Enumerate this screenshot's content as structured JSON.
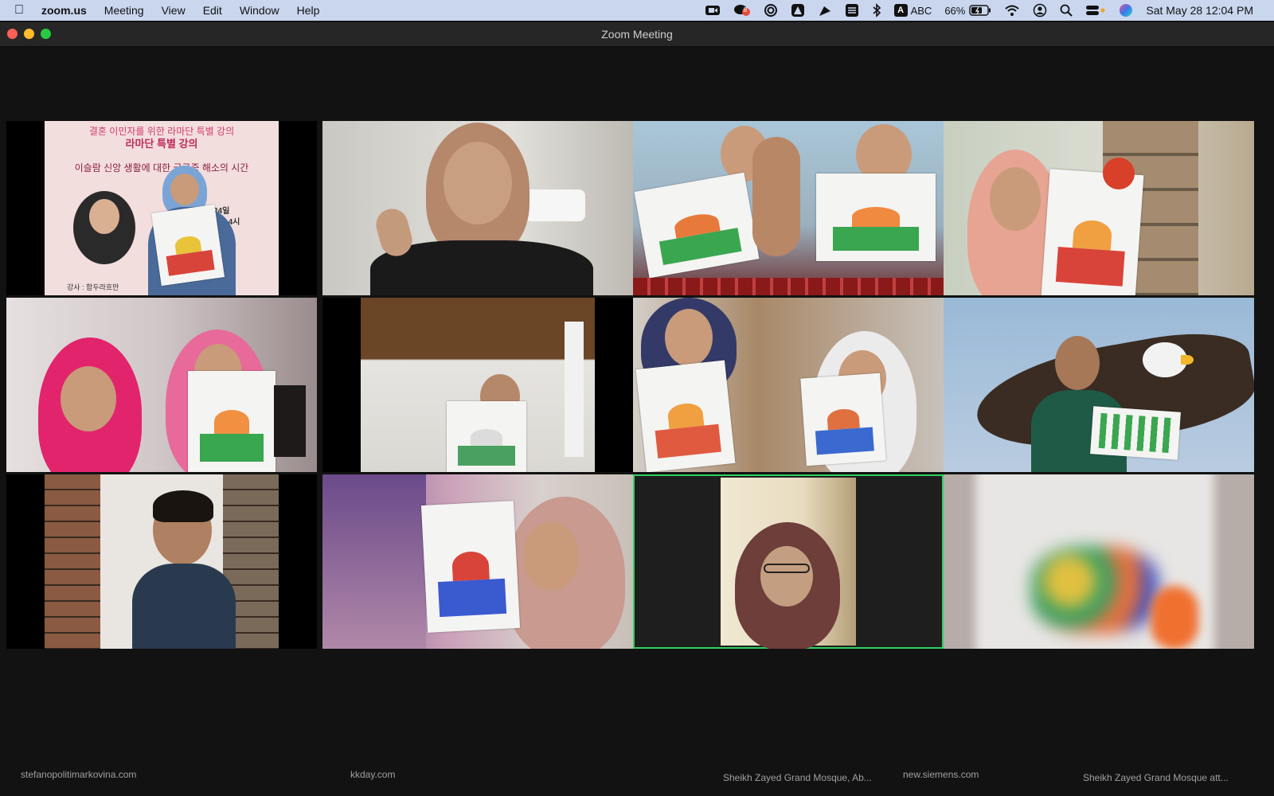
{
  "menubar": {
    "app_name": "zoom.us",
    "menus": [
      "Meeting",
      "View",
      "Edit",
      "Window",
      "Help"
    ],
    "input_source": "ABC",
    "battery": "66%",
    "datetime": "Sat May 28  12:04 PM",
    "notification_badge": "8"
  },
  "window": {
    "title": "Zoom Meeting"
  },
  "bottom_strip": {
    "items": [
      "stefanopolitimarkovina.com",
      "kkday.com",
      "Sheikh Zayed Grand Mosque, Ab...",
      "new.siemens.com",
      "Sheikh Zayed Grand Mosque att..."
    ]
  },
  "colors": {
    "active_speaker_border": "#2fd15f",
    "window_bg": "#121212",
    "menubar_bg": "#c9d6ee"
  },
  "tiles": [
    {
      "id": 1,
      "poster_title": "결혼 이민자를 위한 라마단 특별 강의",
      "poster_subtitle": "라마단 특별 강의",
      "poster_line": "이슬람 신앙 생활에 대한 궁금증 해소의 시간",
      "poster_date": "월 24일",
      "poster_time": "2시~4시",
      "poster_instructor": "강사 : 함두라흐만"
    },
    {
      "id": 2
    },
    {
      "id": 3
    },
    {
      "id": 4
    },
    {
      "id": 5
    },
    {
      "id": 6
    },
    {
      "id": 7
    },
    {
      "id": 8
    },
    {
      "id": 9
    },
    {
      "id": 10
    },
    {
      "id": 11,
      "active_speaker": true
    },
    {
      "id": 12
    }
  ]
}
